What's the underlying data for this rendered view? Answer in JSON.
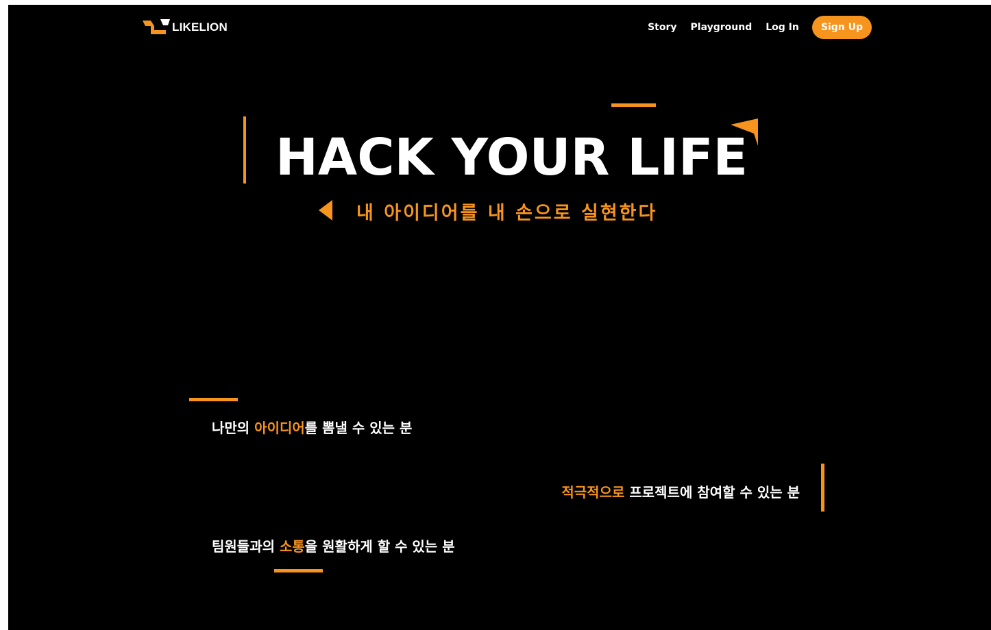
{
  "header": {
    "logo_text": "LIKELION",
    "nav": {
      "story": "Story",
      "playground": "Playground",
      "login": "Log In",
      "signup": "Sign Up"
    }
  },
  "hero": {
    "title": "HACK YOUR LIFE",
    "subtitle": "내 아이디어를 내 손으로 실현한다"
  },
  "criteria": [
    {
      "before": "나만의 ",
      "highlight": "아이디어",
      "after": "를 뽐낼 수 있는 분"
    },
    {
      "before": "",
      "highlight": "적극적으로",
      "after": " 프로젝트에 참여할 수 있는 분"
    },
    {
      "before": "팀원들과의 ",
      "highlight": "소통",
      "after": "을 원활하게 할 수 있는 분"
    }
  ],
  "colors": {
    "accent": "#f7941d",
    "background": "#000000",
    "text": "#ffffff"
  }
}
